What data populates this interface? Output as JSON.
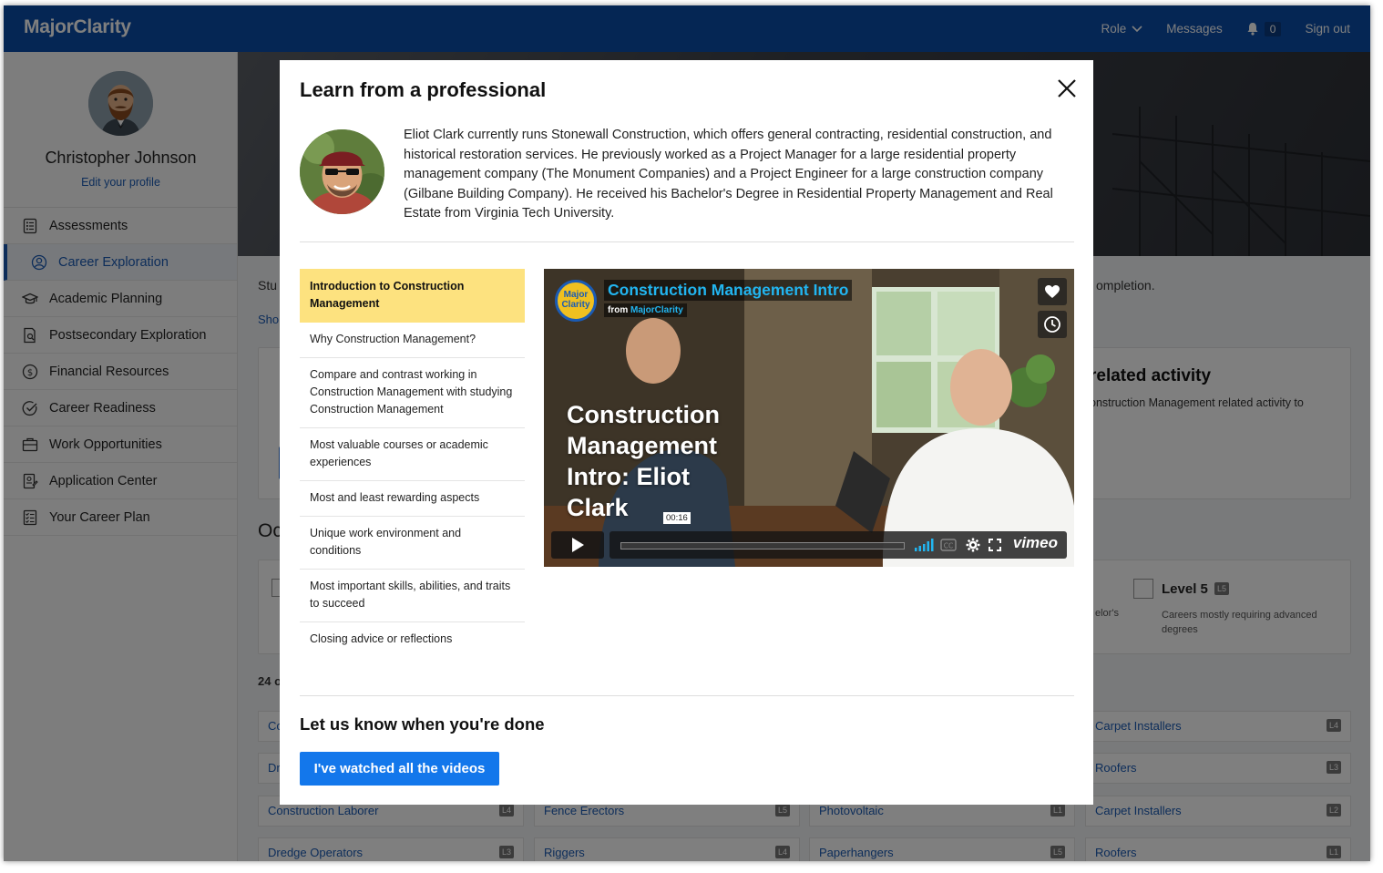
{
  "app": {
    "brand": "MajorClarity"
  },
  "topnav": {
    "role_label": "Role",
    "messages_label": "Messages",
    "notification_count": "0",
    "signout_label": "Sign out"
  },
  "profile": {
    "name": "Christopher Johnson",
    "edit_label": "Edit your profile"
  },
  "sidebar": {
    "items": [
      {
        "label": "Assessments",
        "icon": "clipboard-list-icon"
      },
      {
        "label": "Career Exploration",
        "icon": "person-circle-icon",
        "active": true
      },
      {
        "label": "Academic Planning",
        "icon": "graduation-cap-icon"
      },
      {
        "label": "Postsecondary Exploration",
        "icon": "document-search-icon"
      },
      {
        "label": "Financial Resources",
        "icon": "dollar-circle-icon"
      },
      {
        "label": "Career Readiness",
        "icon": "check-circle-icon"
      },
      {
        "label": "Work Opportunities",
        "icon": "briefcase-icon"
      },
      {
        "label": "Application Center",
        "icon": "application-doc-icon"
      },
      {
        "label": "Your Career Plan",
        "icon": "checklist-icon"
      }
    ]
  },
  "background": {
    "stu_fragment": "Stu",
    "completion_fragment": "ompletion.",
    "show_fragment": "Sho",
    "related_activity_fragment": "related activity",
    "related_activity_desc": "onstruction Management related activity to",
    "oc_fragment": "Oc",
    "level5_title": "Level 5",
    "level5_badge": "L5",
    "level5_desc": "Careers mostly requiring advanced degrees",
    "bachelors_fragment": "elor's",
    "count_fragment": "24 o",
    "tiles": [
      {
        "label": "Co",
        "level": ""
      },
      {
        "label": "Carpet Installers",
        "level": "L4"
      },
      {
        "label": "Dr",
        "level": ""
      },
      {
        "label": "Roofers",
        "level": "L3"
      },
      {
        "label": "Construction Laborer",
        "level": "L4"
      },
      {
        "label": "Fence Erectors",
        "level": "L5"
      },
      {
        "label": "Photovoltaic",
        "level": "L1"
      },
      {
        "label": "Carpet Installers",
        "level": "L2"
      },
      {
        "label": "Dredge Operators",
        "level": "L3"
      },
      {
        "label": "Riggers",
        "level": "L4"
      },
      {
        "label": "Paperhangers",
        "level": "L5"
      },
      {
        "label": "Roofers",
        "level": "L1"
      }
    ]
  },
  "modal": {
    "title": "Learn from a professional",
    "bio": "Eliot Clark currently runs Stonewall Construction, which offers general contracting, residential construction, and historical restoration services. He previously worked as a Project Manager for a large residential property management company (The Monument Companies) and a Project Engineer for a large construction company (Gilbane Building Company). He received his Bachelor's Degree in Residential Property Management and Real Estate from Virginia Tech University.",
    "topics": [
      {
        "label": "Introduction to Construction Management",
        "active": true
      },
      {
        "label": "Why Construction Management?"
      },
      {
        "label": "Compare and contrast working in Construction Management with studying Construction Management"
      },
      {
        "label": "Most valuable courses or academic experiences"
      },
      {
        "label": "Most and least rewarding aspects"
      },
      {
        "label": "Unique work environment and conditions"
      },
      {
        "label": "Most important skills, abilities, and traits to succeed"
      },
      {
        "label": "Closing advice or reflections"
      }
    ],
    "video": {
      "logo_text": "Major Clarity",
      "title": "Construction Management Intro",
      "from_prefix": "from",
      "from_channel": "MajorClarity",
      "overlay_text": "Construction Management Intro: Eliot Clark",
      "timestamp": "00:16",
      "progress": 0.0,
      "provider": "vimeo"
    },
    "done_heading": "Let us know when you're done",
    "done_button": "I've watched all the videos"
  },
  "colors": {
    "brand_blue": "#0a4ca8",
    "accent_yellow": "#fde27f",
    "button_blue": "#1377eb",
    "video_title": "#22b5f0"
  }
}
